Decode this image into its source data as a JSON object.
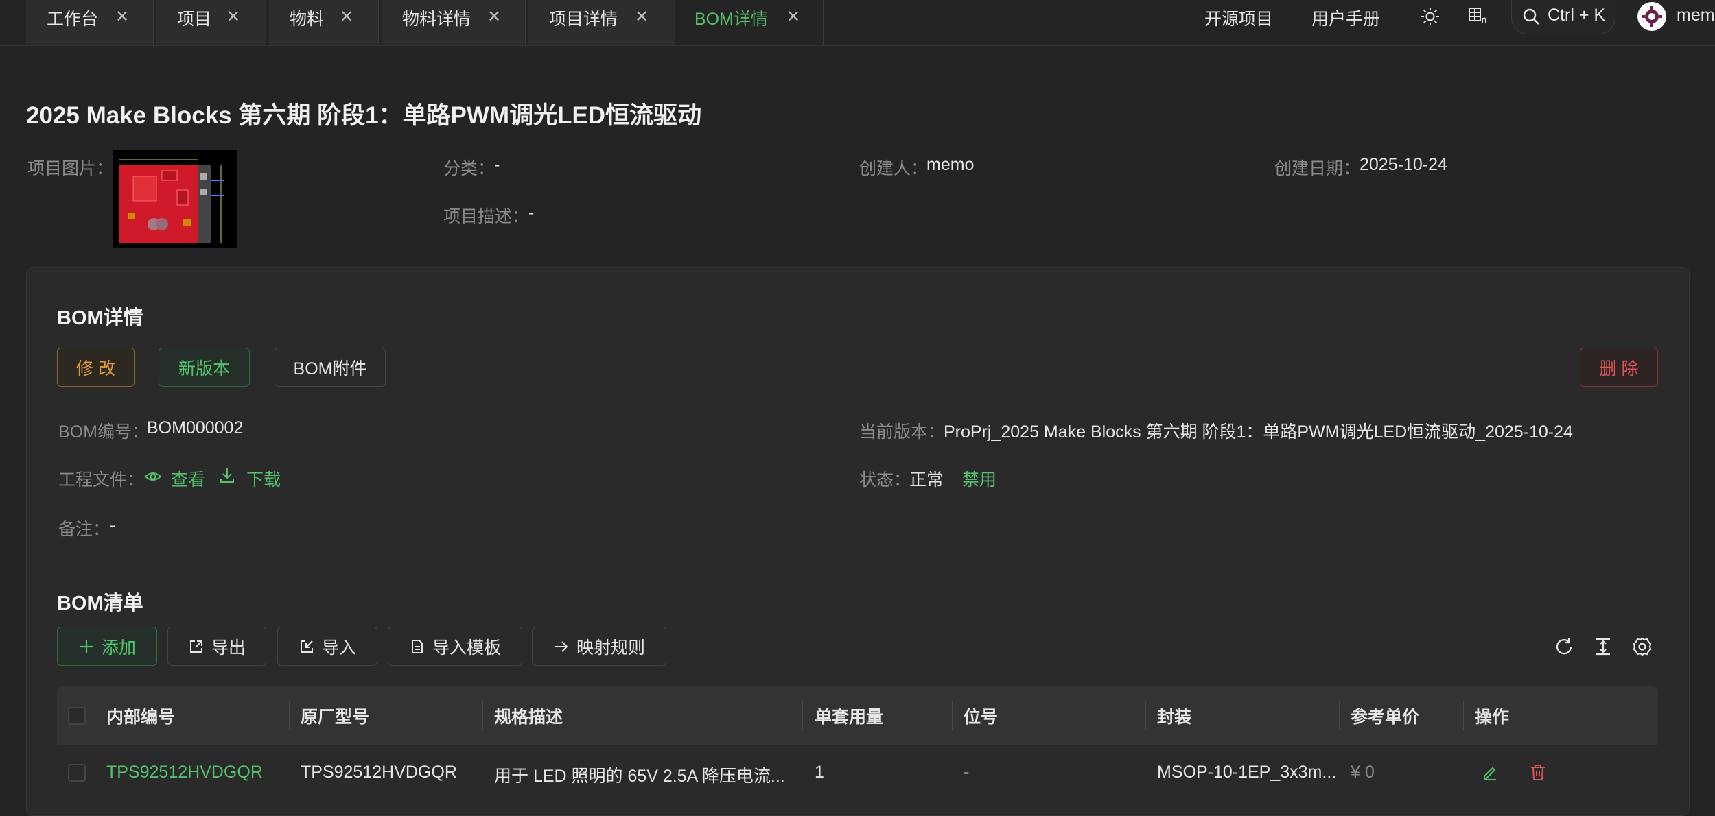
{
  "tabs": [
    {
      "label": "工作台"
    },
    {
      "label": "项目"
    },
    {
      "label": "物料"
    },
    {
      "label": "物料详情"
    },
    {
      "label": "项目详情"
    },
    {
      "label": "BOM详情"
    }
  ],
  "header_links": {
    "open_source": "开源项目",
    "manual": "用户手册"
  },
  "search": {
    "shortcut": "Ctrl + K"
  },
  "user": {
    "name": "mem"
  },
  "project": {
    "title": "2025 Make Blocks 第六期 阶段1：单路PWM调光LED恒流驱动",
    "image_label": "项目图片：",
    "category_label": "分类：",
    "category": "-",
    "creator_label": "创建人：",
    "creator": "memo",
    "date_label": "创建日期：",
    "date": "2025-10-24",
    "desc_label": "项目描述：",
    "desc": "-"
  },
  "bom": {
    "section_title": "BOM详情",
    "buttons": {
      "edit": "修 改",
      "new_version": "新版本",
      "attachment": "BOM附件",
      "delete": "删 除"
    },
    "code_label": "BOM编号：",
    "code": "BOM000002",
    "version_label": "当前版本：",
    "version": "ProPrj_2025 Make Blocks 第六期 阶段1：单路PWM调光LED恒流驱动_2025-10-24",
    "files_label": "工程文件：",
    "view": "查看",
    "download": "下载",
    "status_label": "状态：",
    "status": "正常",
    "disable": "禁用",
    "note_label": "备注：",
    "note": "-"
  },
  "list": {
    "section_title": "BOM清单",
    "toolbar": {
      "add": "添加",
      "export": "导出",
      "import": "导入",
      "template": "导入模板",
      "mapping": "映射规则"
    },
    "columns": [
      "内部编号",
      "原厂型号",
      "规格描述",
      "单套用量",
      "位号",
      "封装",
      "参考单价",
      "操作"
    ],
    "rows": [
      {
        "internal": "TPS92512HVDGQR",
        "model": "TPS92512HVDGQR",
        "spec": "用于 LED 照明的 65V 2.5A 降压电流...",
        "qty": "1",
        "designator": "-",
        "package": "MSOP-10-1EP_3x3m...",
        "price": "¥ 0"
      }
    ]
  },
  "colors": {
    "accent": "#52c26b",
    "warn": "#e39a33",
    "danger": "#e05555",
    "background": "#242424"
  }
}
